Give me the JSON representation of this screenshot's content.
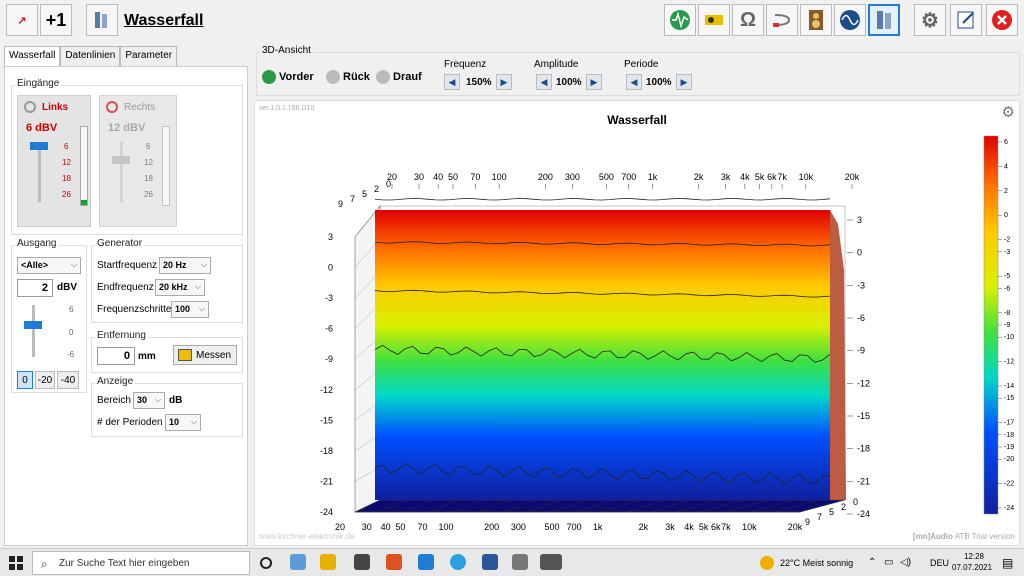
{
  "window": {
    "title": "Wasserfall",
    "plus_label": "+1"
  },
  "left_tabs": [
    "Wasserfall",
    "Datenlinien",
    "Parameter"
  ],
  "inputs_group": {
    "title": "Eingänge",
    "left": {
      "name": "Links",
      "level": "6 dBV",
      "scale": [
        "6",
        "12",
        "18",
        "26"
      ]
    },
    "right": {
      "name": "Rechts",
      "level": "12 dBV",
      "scale": [
        "6",
        "12",
        "18",
        "26"
      ]
    }
  },
  "output_group": {
    "title": "Ausgang",
    "channel": "<Alle>",
    "value": "2",
    "unit": "dBV",
    "scale": [
      "6",
      "0",
      "-6"
    ],
    "atten": [
      "0",
      "-20",
      "-40"
    ]
  },
  "generator_group": {
    "title": "Generator",
    "start_label": "Startfrequenz",
    "start_value": "20 Hz",
    "end_label": "Endfrequenz",
    "end_value": "20 kHz",
    "steps_label": "Frequenzschritte",
    "steps_value": "100"
  },
  "distance_group": {
    "title": "Entfernung",
    "value": "0",
    "unit": "mm",
    "measure_label": "Messen"
  },
  "display_group": {
    "title": "Anzeige",
    "range_label": "Bereich",
    "range_value": "30",
    "range_unit": "dB",
    "periods_label": "# der Perioden",
    "periods_value": "10"
  },
  "view3d": {
    "title": "3D-Ansicht",
    "views": [
      "Vorder",
      "Rück",
      "Drauf"
    ],
    "frequency": {
      "label": "Frequenz",
      "value": "150%"
    },
    "amplitude": {
      "label": "Amplitude",
      "value": "100%"
    },
    "period": {
      "label": "Periode",
      "value": "100%"
    }
  },
  "version_text": "ver.1.0.1.166.D10",
  "watermark": "www.kirchner-elektronik.de",
  "brand": {
    "bracket": "[mn]",
    "name": "Audio",
    "suffix": " ATB Trial version"
  },
  "chart_data": {
    "type": "heatmap",
    "title": "Wasserfall",
    "x_ticks_top": [
      "20",
      "30",
      "40",
      "50",
      "70",
      "100",
      "200",
      "300",
      "500",
      "700",
      "1k",
      "2k",
      "3k",
      "4k",
      "5k",
      "6k",
      "7k",
      "10k",
      "20k"
    ],
    "x_ticks_bottom": [
      "20",
      "30",
      "40",
      "50",
      "70",
      "100",
      "200",
      "300",
      "500",
      "700",
      "1k",
      "2k",
      "3k",
      "4k",
      "5k",
      "6k",
      "7k",
      "10k",
      "20k"
    ],
    "y_ticks_left": [
      "3",
      "0",
      "-3",
      "-6",
      "-9",
      "-12",
      "-15",
      "-18",
      "-21",
      "-24"
    ],
    "y_ticks_right": [
      "3",
      "0",
      "-3",
      "-6",
      "-9",
      "-12",
      "-15",
      "-18",
      "-21",
      "-24"
    ],
    "period_ticks_back": [
      "9",
      "7",
      "5",
      "2",
      "0"
    ],
    "period_ticks_front": [
      "9",
      "7",
      "5",
      "2",
      "0"
    ],
    "colorbar_ticks": [
      "6",
      "4",
      "2",
      "0",
      "-2",
      "-3",
      "-5",
      "-6",
      "-8",
      "-9",
      "-10",
      "-12",
      "-14",
      "-15",
      "-17",
      "-18",
      "-19",
      "-20",
      "-22",
      "-24"
    ],
    "colorscale": [
      "#e00000",
      "#ff6a00",
      "#ffc800",
      "#d8f000",
      "#40e040",
      "#00d8c8",
      "#0050ff",
      "#1020a0"
    ],
    "x_range_hz": [
      20,
      20000
    ],
    "y_range_db": [
      -24,
      3
    ],
    "contours_db": [
      4,
      0,
      -4.5,
      -10,
      -21
    ],
    "grid": true
  },
  "taskbar": {
    "search_placeholder": "Zur Suche Text hier eingeben",
    "weather": "22°C  Meist sonnig",
    "lang": "DEU",
    "time": "12:28",
    "date": "07.07.2021"
  }
}
